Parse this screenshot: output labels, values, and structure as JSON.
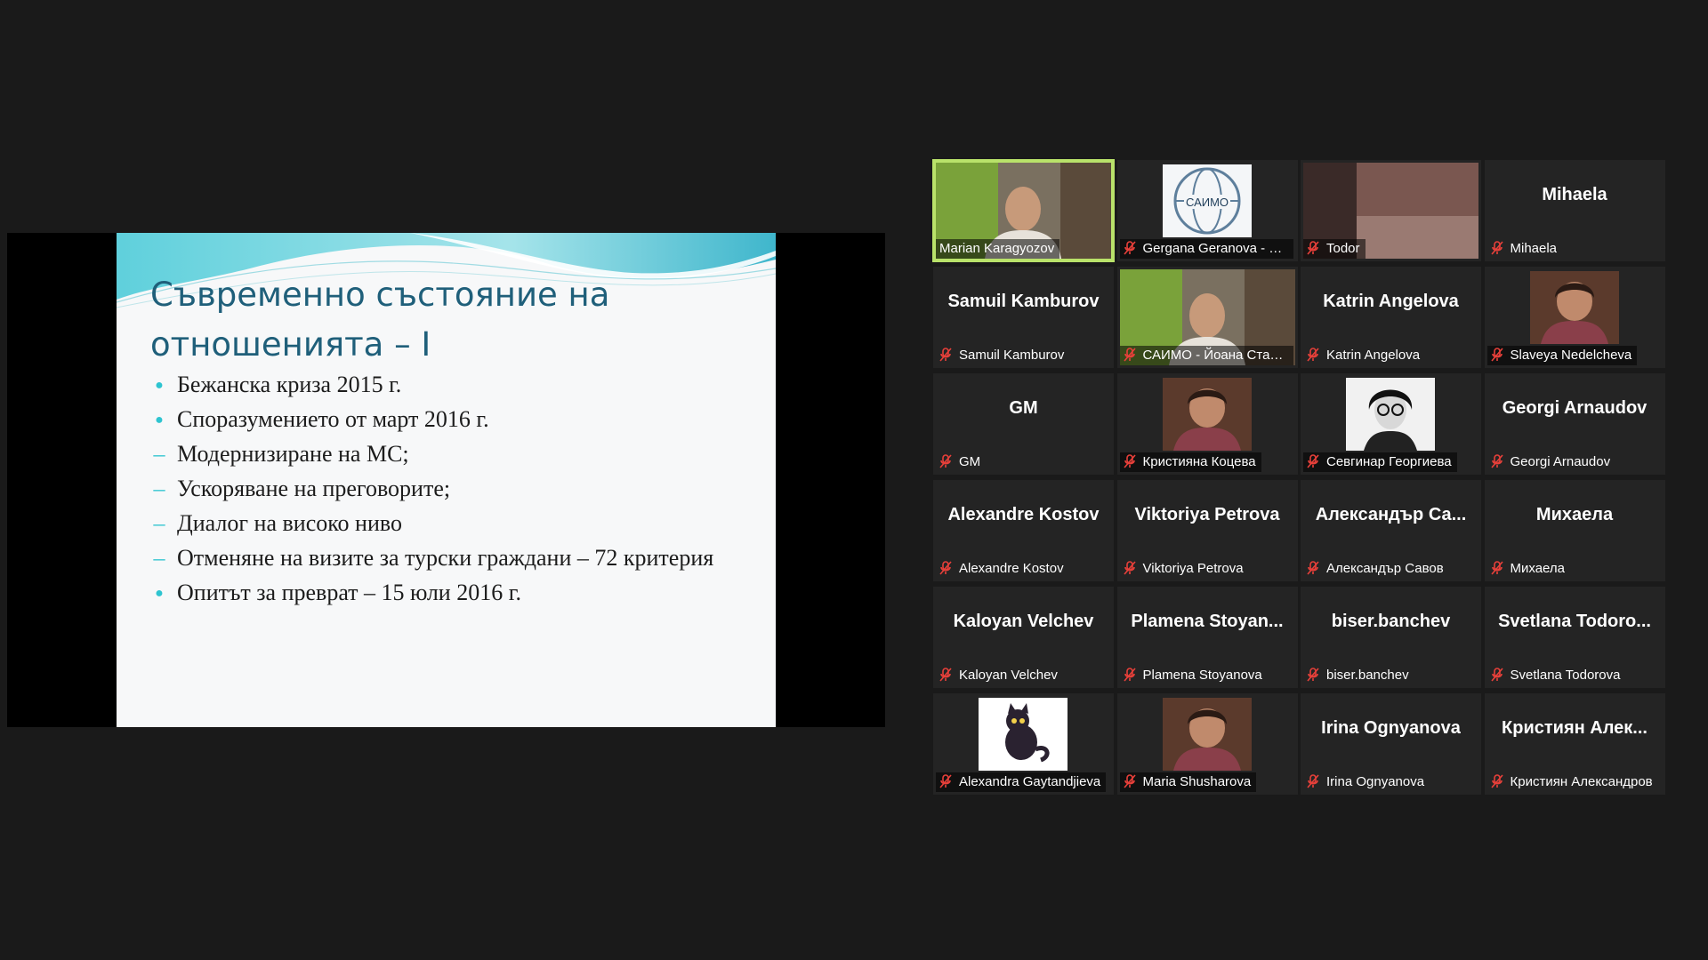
{
  "slide": {
    "title_line1": "Съвременно състояние на",
    "title_line2": "отношенията – I",
    "bullets": [
      {
        "text": "Бежанска криза 2015 г.",
        "marker": "dot"
      },
      {
        "text": "Споразумението от март 2016 г.",
        "marker": "dot"
      },
      {
        "text": "Модернизиране на МС;",
        "marker": "dash"
      },
      {
        "text": "Ускоряване на преговорите;",
        "marker": "dash"
      },
      {
        "text": "Диалог на високо ниво",
        "marker": "dash"
      },
      {
        "text": "Отменяне на визите за турски граждани – 72 критерия",
        "marker": "dash"
      },
      {
        "text": "Опитът за преврат – 15 юли 2016 г.",
        "marker": "dot"
      }
    ],
    "accent_color": "#2ec4d0",
    "title_color": "#1f5f7a"
  },
  "participants": [
    {
      "label": "Marian Karagyozov",
      "big": "",
      "muted": false,
      "active": true,
      "video": "person-webcam"
    },
    {
      "label": "Gergana Geranova - С...",
      "big": "",
      "muted": true,
      "active": false,
      "video": "saimo-logo",
      "logo_text": "САИМО"
    },
    {
      "label": "Todor",
      "big": "",
      "muted": true,
      "active": false,
      "video": "dark-room"
    },
    {
      "label": "Mihaela",
      "big": "Mihaela",
      "muted": true,
      "active": false,
      "video": ""
    },
    {
      "label": "Samuil Kamburov",
      "big": "Samuil Kamburov",
      "muted": true,
      "active": false,
      "video": ""
    },
    {
      "label": "САИМО - Йоана Стам...",
      "big": "",
      "muted": true,
      "active": false,
      "video": "person-webcam"
    },
    {
      "label": "Katrin Angelova",
      "big": "Katrin Angelova",
      "muted": true,
      "active": false,
      "video": ""
    },
    {
      "label": "Slaveya Nedelcheva",
      "big": "",
      "muted": true,
      "active": false,
      "video": "avatar-photo"
    },
    {
      "label": "GM",
      "big": "GM",
      "muted": true,
      "active": false,
      "video": ""
    },
    {
      "label": "Кристияна Коцева",
      "big": "",
      "muted": true,
      "active": false,
      "video": "avatar-photo"
    },
    {
      "label": "Севгинар Георгиева",
      "big": "",
      "muted": true,
      "active": false,
      "video": "avatar-photo-bw"
    },
    {
      "label": "Georgi Arnaudov",
      "big": "Georgi Arnaudov",
      "muted": true,
      "active": false,
      "video": ""
    },
    {
      "label": "Alexandre Kostov",
      "big": "Alexandre Kostov",
      "muted": true,
      "active": false,
      "video": ""
    },
    {
      "label": "Viktoriya Petrova",
      "big": "Viktoriya Petrova",
      "muted": true,
      "active": false,
      "video": ""
    },
    {
      "label": "Александър Савов",
      "big": "Александър Са...",
      "muted": true,
      "active": false,
      "video": ""
    },
    {
      "label": "Михаела",
      "big": "Михаела",
      "muted": true,
      "active": false,
      "video": ""
    },
    {
      "label": "Kaloyan Velchev",
      "big": "Kaloyan Velchev",
      "muted": true,
      "active": false,
      "video": ""
    },
    {
      "label": "Plamena Stoyanova",
      "big": "Plamena Stoyan...",
      "muted": true,
      "active": false,
      "video": ""
    },
    {
      "label": "biser.banchev",
      "big": "biser.banchev",
      "muted": true,
      "active": false,
      "video": ""
    },
    {
      "label": "Svetlana Todorova",
      "big": "Svetlana Todoro...",
      "muted": true,
      "active": false,
      "video": ""
    },
    {
      "label": "Alexandra Gaytandjieva",
      "big": "",
      "muted": true,
      "active": false,
      "video": "cat-avatar"
    },
    {
      "label": "Maria Shusharova",
      "big": "",
      "muted": true,
      "active": false,
      "video": "avatar-photo"
    },
    {
      "label": "Irina Ognyanova",
      "big": "Irina Ognyanova",
      "muted": true,
      "active": false,
      "video": ""
    },
    {
      "label": "Кристиян Александров",
      "big": "Кристиян Алек...",
      "muted": true,
      "active": false,
      "video": ""
    }
  ],
  "colors": {
    "active_speaker": "#b9e26a",
    "muted_icon": "#e8403a",
    "tile_bg": "#242424"
  }
}
